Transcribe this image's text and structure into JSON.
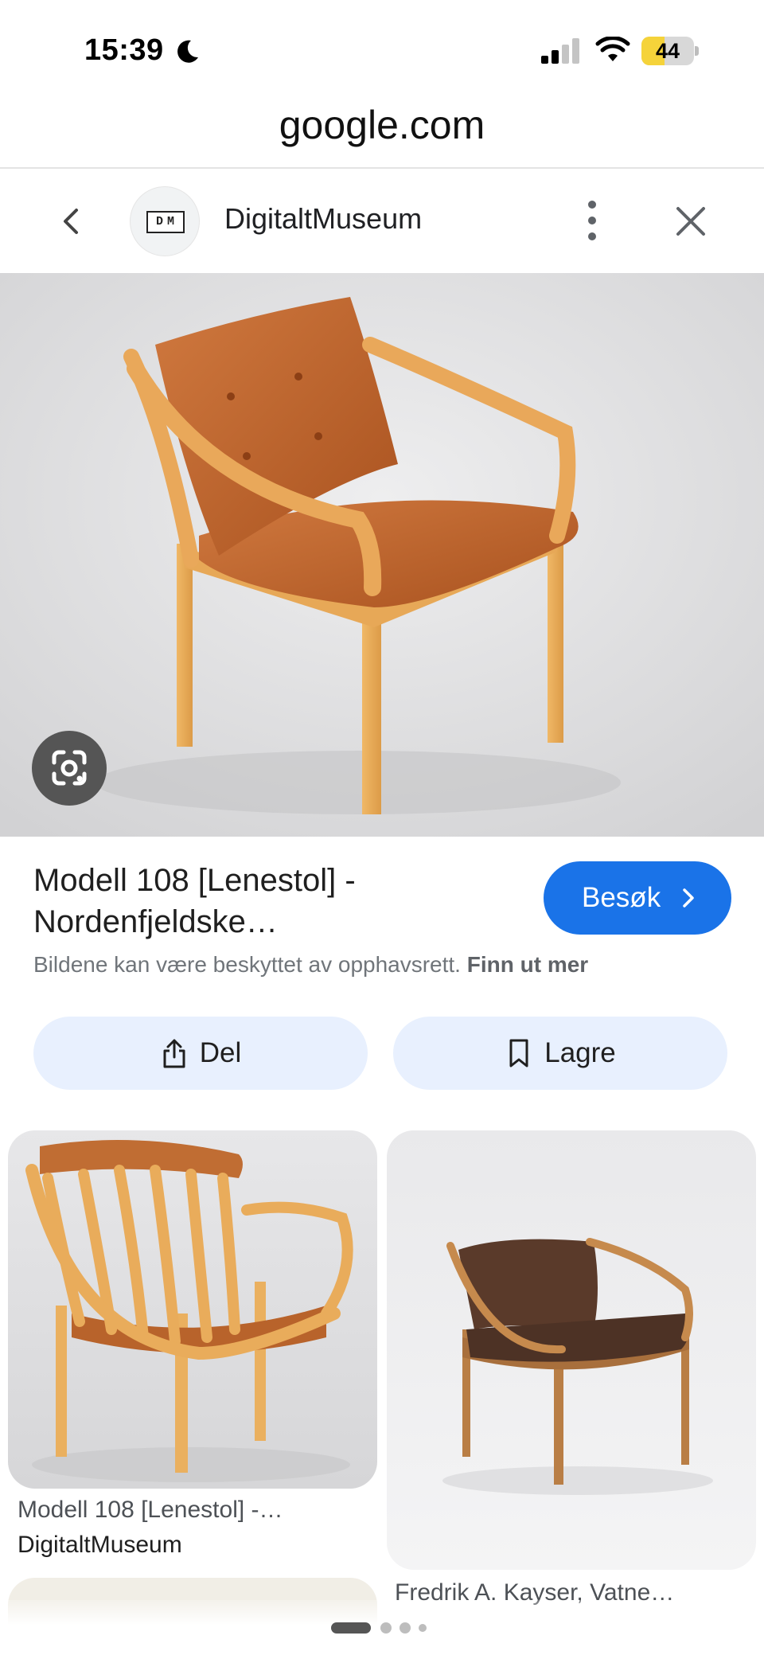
{
  "status_bar": {
    "time": "15:39",
    "battery": "44",
    "battery_level": 0.44,
    "icons": [
      "moon-icon",
      "signal-icon",
      "wifi-icon",
      "battery-icon"
    ]
  },
  "url_bar": {
    "domain": "google.com"
  },
  "source_header": {
    "name": "DigitaltMuseum",
    "logo_text": "DM",
    "icons": [
      "back-arrow-icon",
      "more-vert-icon",
      "close-icon"
    ]
  },
  "hero": {
    "lens_icon": "google-lens-icon"
  },
  "result": {
    "title": "Modell 108 [Lenestol] - Nordenfjeldske…",
    "visit_label": "Besøk",
    "copyright_text": "Bildene kan være beskyttet av opphavsrett.",
    "learn_more": "Finn ut mer"
  },
  "actions": {
    "share_label": "Del",
    "save_label": "Lagre"
  },
  "related": [
    {
      "title": "Modell 108 [Lenestol] -…",
      "source": "DigitaltMuseum"
    },
    {
      "title": "Fredrik A. Kayser, Vatne…"
    }
  ],
  "pagination": {
    "count": 4,
    "active": 0
  },
  "colors": {
    "accent": "#1a73e8",
    "chip": "#e8f0fe",
    "battery": "#f5d33a"
  }
}
